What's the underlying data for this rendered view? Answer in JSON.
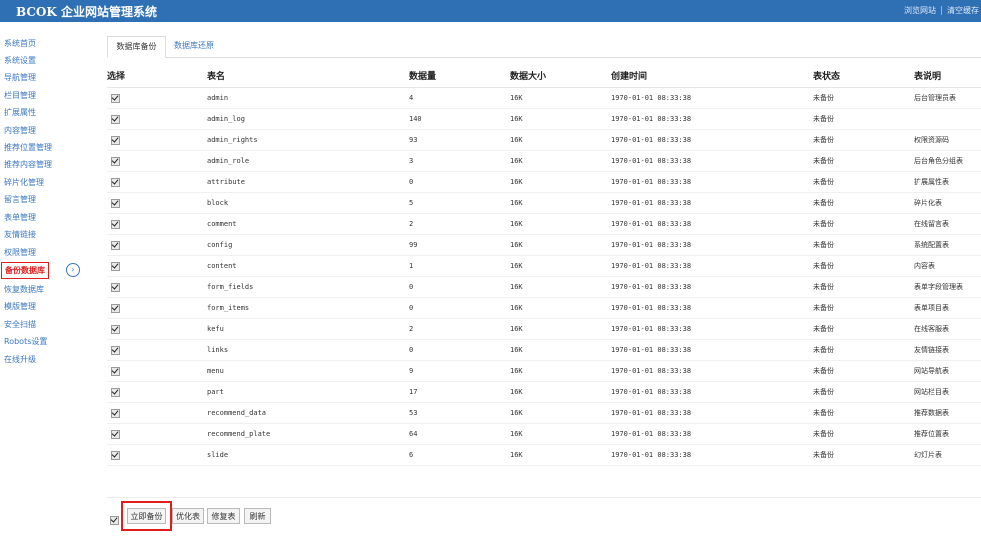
{
  "header": {
    "title": "BCOK 企业网站管理系统",
    "links": [
      "浏览网站",
      "清空缓存"
    ]
  },
  "sidebar": {
    "items": [
      {
        "label": "系统首页"
      },
      {
        "label": "系统设置"
      },
      {
        "label": "导航管理"
      },
      {
        "label": "栏目管理"
      },
      {
        "label": "扩展属性"
      },
      {
        "label": "内容管理"
      },
      {
        "label": "推荐位置管理"
      },
      {
        "label": "推荐内容管理"
      },
      {
        "label": "碎片化管理"
      },
      {
        "label": "留言管理"
      },
      {
        "label": "表单管理"
      },
      {
        "label": "友情链接"
      },
      {
        "label": "权限管理"
      },
      {
        "label": "备份数据库",
        "active": true
      },
      {
        "label": "恢复数据库"
      },
      {
        "label": "模版管理"
      },
      {
        "label": "安全扫描"
      },
      {
        "label": "Robots设置"
      },
      {
        "label": "在线升级"
      }
    ],
    "arrow_icon": "chevron-right-circle-icon"
  },
  "tabs": [
    {
      "label": "数据库备份",
      "active": true
    },
    {
      "label": "数据库还原",
      "active": false
    }
  ],
  "table": {
    "headers": [
      "选择",
      "表名",
      "数据量",
      "数据大小",
      "创建时间",
      "表状态",
      "表说明"
    ],
    "rows": [
      {
        "name": "admin",
        "count": "4",
        "size": "16K",
        "created": "1970-01-01 08:33:38",
        "status": "未备份",
        "desc": "后台管理员表"
      },
      {
        "name": "admin_log",
        "count": "140",
        "size": "16K",
        "created": "1970-01-01 08:33:38",
        "status": "未备份",
        "desc": ""
      },
      {
        "name": "admin_rights",
        "count": "93",
        "size": "16K",
        "created": "1970-01-01 08:33:38",
        "status": "未备份",
        "desc": "权限资源码"
      },
      {
        "name": "admin_role",
        "count": "3",
        "size": "16K",
        "created": "1970-01-01 08:33:38",
        "status": "未备份",
        "desc": "后台角色分组表"
      },
      {
        "name": "attribute",
        "count": "0",
        "size": "16K",
        "created": "1970-01-01 08:33:38",
        "status": "未备份",
        "desc": "扩展属性表"
      },
      {
        "name": "block",
        "count": "5",
        "size": "16K",
        "created": "1970-01-01 08:33:38",
        "status": "未备份",
        "desc": "碎片化表"
      },
      {
        "name": "comment",
        "count": "2",
        "size": "16K",
        "created": "1970-01-01 08:33:38",
        "status": "未备份",
        "desc": "在线留言表"
      },
      {
        "name": "config",
        "count": "99",
        "size": "16K",
        "created": "1970-01-01 08:33:38",
        "status": "未备份",
        "desc": "系统配置表"
      },
      {
        "name": "content",
        "count": "1",
        "size": "16K",
        "created": "1970-01-01 08:33:38",
        "status": "未备份",
        "desc": "内容表"
      },
      {
        "name": "form_fields",
        "count": "0",
        "size": "16K",
        "created": "1970-01-01 08:33:38",
        "status": "未备份",
        "desc": "表单字段管理表"
      },
      {
        "name": "form_items",
        "count": "0",
        "size": "16K",
        "created": "1970-01-01 08:33:38",
        "status": "未备份",
        "desc": "表单项目表"
      },
      {
        "name": "kefu",
        "count": "2",
        "size": "16K",
        "created": "1970-01-01 08:33:38",
        "status": "未备份",
        "desc": "在线客服表"
      },
      {
        "name": "links",
        "count": "0",
        "size": "16K",
        "created": "1970-01-01 08:33:38",
        "status": "未备份",
        "desc": "友情链接表"
      },
      {
        "name": "menu",
        "count": "9",
        "size": "16K",
        "created": "1970-01-01 08:33:38",
        "status": "未备份",
        "desc": "网站导航表"
      },
      {
        "name": "part",
        "count": "17",
        "size": "16K",
        "created": "1970-01-01 08:33:38",
        "status": "未备份",
        "desc": "网站栏目表"
      },
      {
        "name": "recommend_data",
        "count": "53",
        "size": "16K",
        "created": "1970-01-01 08:33:38",
        "status": "未备份",
        "desc": "推荐数据表"
      },
      {
        "name": "recommend_plate",
        "count": "64",
        "size": "16K",
        "created": "1970-01-01 08:33:38",
        "status": "未备份",
        "desc": "推荐位置表"
      },
      {
        "name": "slide",
        "count": "6",
        "size": "16K",
        "created": "1970-01-01 08:33:38",
        "status": "未备份",
        "desc": "幻灯片表"
      }
    ]
  },
  "actions": {
    "backup_now": "立即备份",
    "optimize": "优化表",
    "repair": "修复表",
    "refresh": "刷新"
  },
  "colors": {
    "header_bg": "#2f6fb4",
    "link": "#3a77c2",
    "highlight": "#e01e1e"
  }
}
